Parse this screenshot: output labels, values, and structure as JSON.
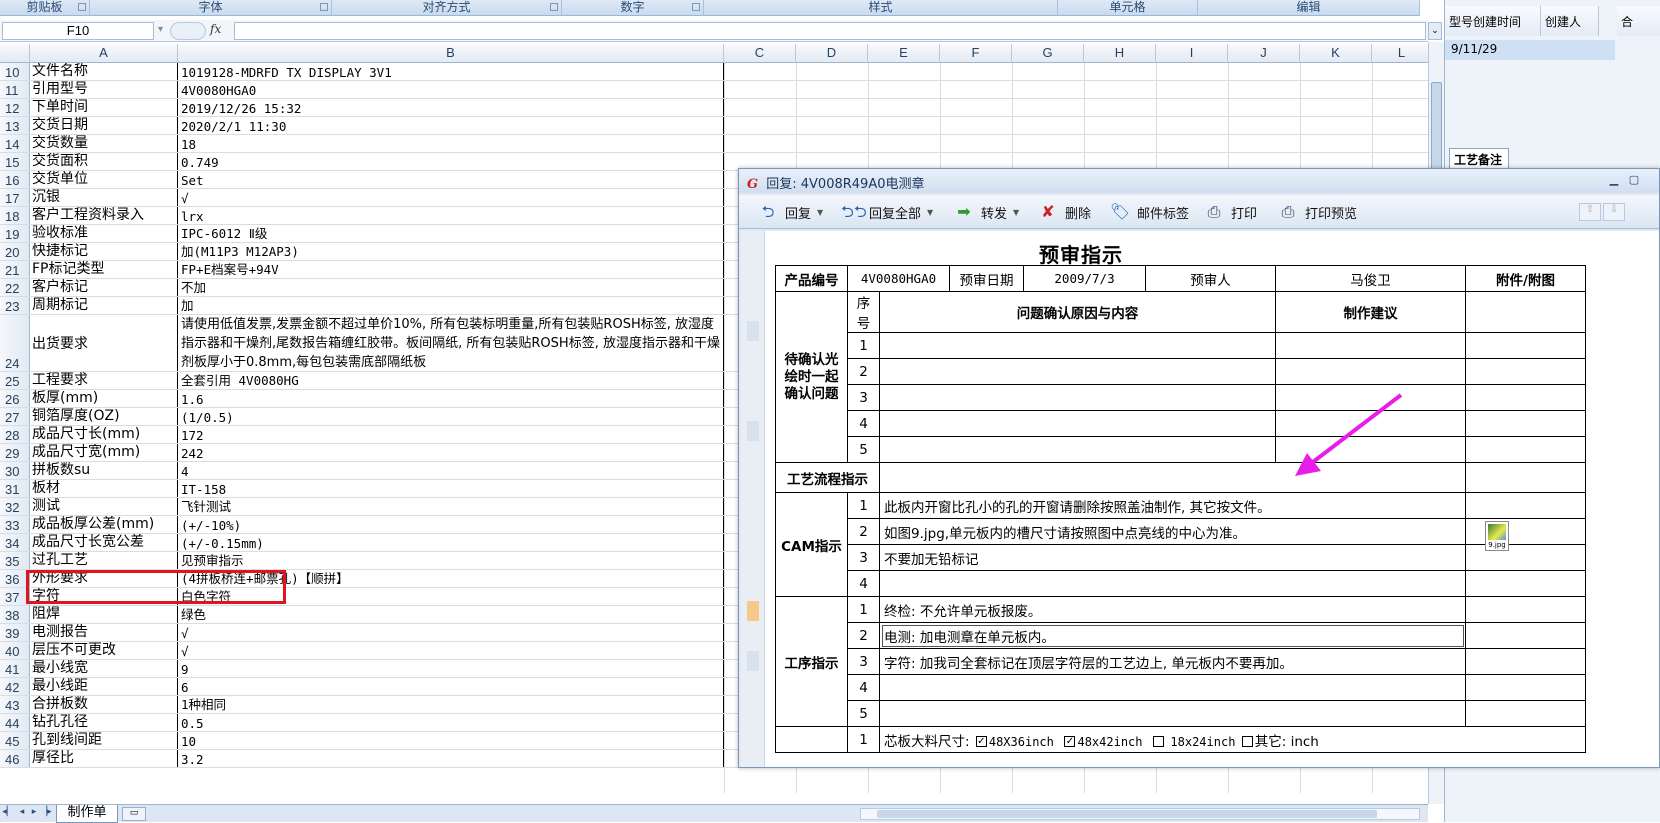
{
  "ribbon": {
    "groups": [
      "剪贴板",
      "字体",
      "对齐方式",
      "数字",
      "样式",
      "单元格",
      "编辑"
    ]
  },
  "formula_bar": {
    "cell_ref": "F10",
    "fx_label": "fx",
    "value": ""
  },
  "sheet": {
    "columns": [
      "A",
      "B",
      "C",
      "D",
      "E",
      "F",
      "G",
      "H",
      "I",
      "J",
      "K",
      "L"
    ],
    "rows": [
      {
        "n": "10",
        "a": "文件名称",
        "b": "1019128-MDRFD TX DISPLAY 3V1"
      },
      {
        "n": "11",
        "a": "引用型号",
        "b": "4V0080HGA0"
      },
      {
        "n": "12",
        "a": "下单时间",
        "b": "2019/12/26 15:32"
      },
      {
        "n": "13",
        "a": "交货日期",
        "b": "2020/2/1 11:30"
      },
      {
        "n": "14",
        "a": "交货数量",
        "b": "18"
      },
      {
        "n": "15",
        "a": "交货面积",
        "b": "0.749"
      },
      {
        "n": "16",
        "a": "交货单位",
        "b": "Set"
      },
      {
        "n": "17",
        "a": "沉银",
        "b": "√"
      },
      {
        "n": "18",
        "a": "客户工程资料录入",
        "b": "lrx"
      },
      {
        "n": "19",
        "a": "验收标准",
        "b": "IPC-6012 Ⅱ级"
      },
      {
        "n": "20",
        "a": "快捷标记",
        "b": "加(M11P3 M12AP3)"
      },
      {
        "n": "21",
        "a": "FP标记类型",
        "b": "FP+E档案号+94V"
      },
      {
        "n": "22",
        "a": "客户标记",
        "b": "不加"
      },
      {
        "n": "23",
        "a": "周期标记",
        "b": "加"
      },
      {
        "n": "24",
        "a": "出货要求",
        "b": "请使用低值发票,发票金额不超过单价10%, 所有包装标明重量,所有包装贴ROSH标签, 放湿度指示器和干燥剂,尾数报告箱缠红胶带。板间隔纸, 所有包装贴ROSH标签, 放湿度指示器和干燥剂板厚小于0.8mm,每包包装需底部隔纸板"
      },
      {
        "n": "25",
        "a": "工程要求",
        "b": "全套引用  4V0080HG"
      },
      {
        "n": "26",
        "a": "板厚(mm)",
        "b": "1.6"
      },
      {
        "n": "27",
        "a": "铜箔厚度(OZ)",
        "b": "(1/0.5)"
      },
      {
        "n": "28",
        "a": "成品尺寸长(mm)",
        "b": "172"
      },
      {
        "n": "29",
        "a": "成品尺寸宽(mm)",
        "b": "242"
      },
      {
        "n": "30",
        "a": "拼板数su",
        "b": "4"
      },
      {
        "n": "31",
        "a": "板材",
        "b": "IT-158"
      },
      {
        "n": "32",
        "a": "测试",
        "b": "飞针测试"
      },
      {
        "n": "33",
        "a": "成品板厚公差(mm)",
        "b": "(+/-10%)"
      },
      {
        "n": "34",
        "a": "成品尺寸长宽公差",
        "b": "(+/-0.15mm)"
      },
      {
        "n": "35",
        "a": "过孔工艺",
        "b": "见预审指示"
      },
      {
        "n": "36",
        "a": "外形要求",
        "b": "(4拼板桥连+邮票孔)【顺拼】"
      },
      {
        "n": "37",
        "a": "字符",
        "b": "白色字符"
      },
      {
        "n": "38",
        "a": "阻焊",
        "b": "绿色"
      },
      {
        "n": "39",
        "a": "电测报告",
        "b": "√"
      },
      {
        "n": "40",
        "a": "层压不可更改",
        "b": "√"
      },
      {
        "n": "41",
        "a": "最小线宽",
        "b": "9"
      },
      {
        "n": "42",
        "a": "最小线距",
        "b": "6"
      },
      {
        "n": "43",
        "a": "合拼板数",
        "b": "1种相同"
      },
      {
        "n": "44",
        "a": "钻孔孔径",
        "b": "0.5"
      },
      {
        "n": "45",
        "a": "孔到线间距",
        "b": "10"
      },
      {
        "n": "46",
        "a": "厚径比",
        "b": "3.2"
      }
    ],
    "tab_label": "制作单"
  },
  "right_panel": {
    "headers": [
      "型号创建时间",
      "创建人",
      "合"
    ],
    "row_value": "9/11/29",
    "tab_label": "工艺备注"
  },
  "mail": {
    "title": "回复: 4V008R49A0电测章",
    "logo": "G",
    "toolbar": {
      "reply": "回复",
      "reply_all": "回复全部",
      "forward": "转发",
      "delete": "删除",
      "tag": "邮件标签",
      "print": "打印",
      "print_preview": "打印预览"
    },
    "doc": {
      "heading": "预审指示",
      "product_no_label": "产品编号",
      "product_no": "4V0080HGA0",
      "review_date_label": "预审日期",
      "review_date": "2009/7/3",
      "reviewer_label": "预审人",
      "reviewer": "马俊卫",
      "attach_label": "附件/附图",
      "seq_label": "序号",
      "problem_label": "问题确认原因与内容",
      "suggest_label": "制作建议",
      "confirm_section": "待确认光绘时一起确认问题",
      "confirm_nums": [
        "1",
        "2",
        "3",
        "4",
        "5"
      ],
      "flow_section": "工艺流程指示",
      "cam_section": "CAM指示",
      "cam_items": [
        {
          "n": "1",
          "text": "此板内开窗比孔小的孔的开窗请删除按照盖油制作, 其它按文件。"
        },
        {
          "n": "2",
          "text": "如图9.jpg,单元板内的槽尺寸请按照图中点亮线的中心为准。"
        },
        {
          "n": "3",
          "text": "不要加无铅标记"
        },
        {
          "n": "4",
          "text": ""
        }
      ],
      "attach_file": "9.jpg",
      "process_section": "工序指示",
      "process_items": [
        {
          "n": "1",
          "text": "终检: 不允许单元板报废。"
        },
        {
          "n": "2",
          "text": "电测: 加电测章在单元板内。"
        },
        {
          "n": "3",
          "text": "字符: 加我司全套标记在顶层字符层的工艺边上, 单元板内不要再加。"
        },
        {
          "n": "4",
          "text": ""
        },
        {
          "n": "5",
          "text": ""
        }
      ],
      "board_row_num": "1",
      "board_label": "芯板大料尺寸:",
      "board_opt1": "48X36inch",
      "board_opt2": "48x42inch",
      "board_opt3": "18x24inch",
      "board_opt4": "其它: inch"
    }
  },
  "colors": {
    "highlight": "#e0141c",
    "arrow": "#e81ee8"
  }
}
